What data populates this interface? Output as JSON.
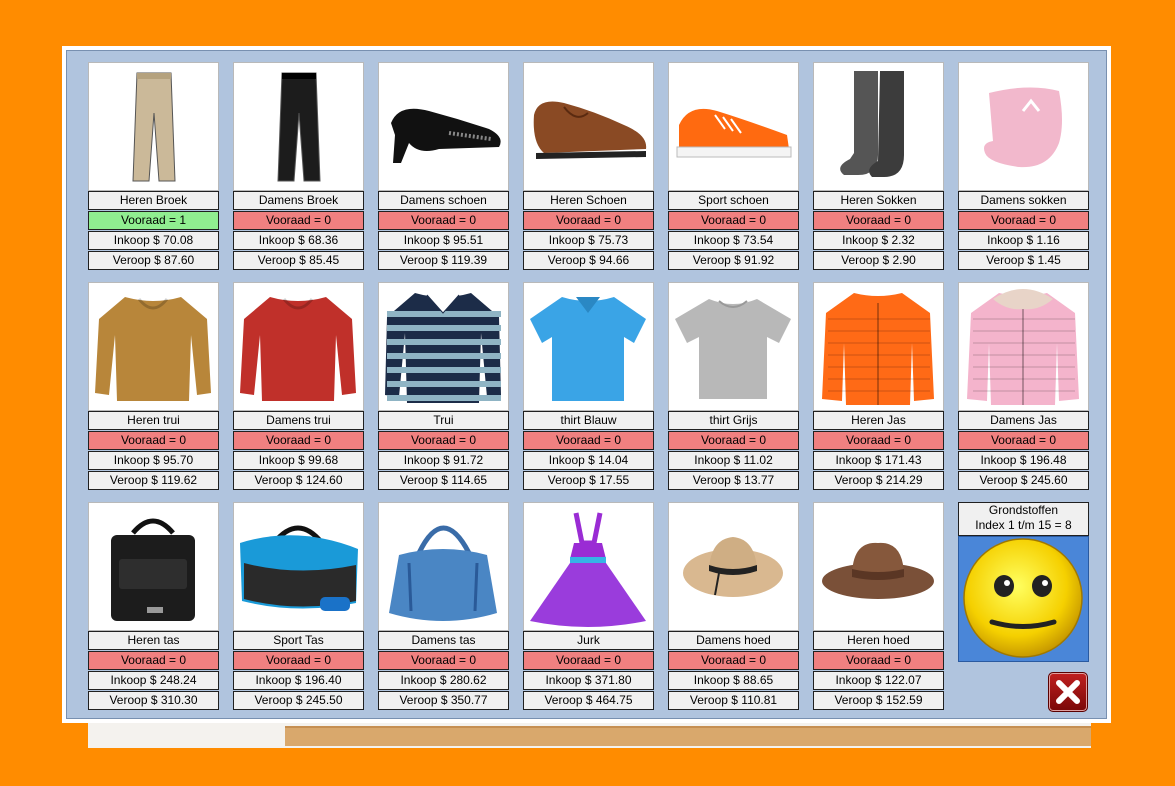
{
  "products": [
    {
      "name": "Heren Broek",
      "stock": "Vooraad = 1",
      "buy": "Inkoop  $ 70.08",
      "sell": "Veroop  $ 87.60",
      "in_stock": true,
      "icon": "pants-icon"
    },
    {
      "name": "Damens Broek",
      "stock": "Vooraad = 0",
      "buy": "Inkoop  $ 68.36",
      "sell": "Veroop  $ 85.45",
      "in_stock": false,
      "icon": "pants-icon"
    },
    {
      "name": "Damens schoen",
      "stock": "Vooraad = 0",
      "buy": "Inkoop  $ 95.51",
      "sell": "Veroop  $ 119.39",
      "in_stock": false,
      "icon": "heel-shoe-icon"
    },
    {
      "name": "Heren Schoen",
      "stock": "Vooraad = 0",
      "buy": "Inkoop  $ 75.73",
      "sell": "Veroop  $ 94.66",
      "in_stock": false,
      "icon": "dress-shoe-icon"
    },
    {
      "name": "Sport schoen",
      "stock": "Vooraad = 0",
      "buy": "Inkoop  $ 73.54",
      "sell": "Veroop  $ 91.92",
      "in_stock": false,
      "icon": "sneaker-icon"
    },
    {
      "name": "Heren Sokken",
      "stock": "Vooraad = 0",
      "buy": "Inkoop  $ 2.32",
      "sell": "Veroop  $ 2.90",
      "in_stock": false,
      "icon": "socks-icon"
    },
    {
      "name": "Damens sokken",
      "stock": "Vooraad = 0",
      "buy": "Inkoop  $ 1.16",
      "sell": "Veroop  $ 1.45",
      "in_stock": false,
      "icon": "sock-icon"
    },
    {
      "name": "Heren trui",
      "stock": "Vooraad = 0",
      "buy": "Inkoop  $ 95.70",
      "sell": "Veroop  $ 119.62",
      "in_stock": false,
      "icon": "sweater-icon"
    },
    {
      "name": "Damens trui",
      "stock": "Vooraad = 0",
      "buy": "Inkoop  $ 99.68",
      "sell": "Veroop  $ 124.60",
      "in_stock": false,
      "icon": "sweater-icon"
    },
    {
      "name": "Trui",
      "stock": "Vooraad = 0",
      "buy": "Inkoop  $ 91.72",
      "sell": "Veroop  $ 114.65",
      "in_stock": false,
      "icon": "striped-sweater-icon"
    },
    {
      "name": "thirt Blauw",
      "stock": "Vooraad = 0",
      "buy": "Inkoop  $ 14.04",
      "sell": "Veroop  $ 17.55",
      "in_stock": false,
      "icon": "polo-shirt-icon"
    },
    {
      "name": "thirt Grijs",
      "stock": "Vooraad = 0",
      "buy": "Inkoop  $ 11.02",
      "sell": "Veroop  $ 13.77",
      "in_stock": false,
      "icon": "tshirt-icon"
    },
    {
      "name": "Heren Jas",
      "stock": "Vooraad = 0",
      "buy": "Inkoop  $ 171.43",
      "sell": "Veroop  $ 214.29",
      "in_stock": false,
      "icon": "jacket-icon"
    },
    {
      "name": "Damens Jas",
      "stock": "Vooraad = 0",
      "buy": "Inkoop  $ 196.48",
      "sell": "Veroop  $ 245.60",
      "in_stock": false,
      "icon": "jacket-icon"
    },
    {
      "name": "Heren tas",
      "stock": "Vooraad = 0",
      "buy": "Inkoop  $ 248.24",
      "sell": "Veroop  $ 310.30",
      "in_stock": false,
      "icon": "laptop-bag-icon"
    },
    {
      "name": "Sport Tas",
      "stock": "Vooraad = 0",
      "buy": "Inkoop  $ 196.40",
      "sell": "Veroop  $ 245.50",
      "in_stock": false,
      "icon": "sport-bag-icon"
    },
    {
      "name": "Damens tas",
      "stock": "Vooraad = 0",
      "buy": "Inkoop  $ 280.62",
      "sell": "Veroop  $ 350.77",
      "in_stock": false,
      "icon": "handbag-icon"
    },
    {
      "name": "Jurk",
      "stock": "Vooraad = 0",
      "buy": "Inkoop  $ 371.80",
      "sell": "Veroop  $ 464.75",
      "in_stock": false,
      "icon": "dress-icon"
    },
    {
      "name": "Damens hoed",
      "stock": "Vooraad = 0",
      "buy": "Inkoop  $ 88.65",
      "sell": "Veroop  $ 110.81",
      "in_stock": false,
      "icon": "sun-hat-icon"
    },
    {
      "name": "Heren hoed",
      "stock": "Vooraad = 0",
      "buy": "Inkoop  $ 122.07",
      "sell": "Veroop  $ 152.59",
      "in_stock": false,
      "icon": "fedora-icon"
    }
  ],
  "grondstoffen": {
    "title": "Grondstoffen",
    "index": "Index 1 t/m 15 =  8"
  },
  "colors": {
    "background": "#ff8c00",
    "panel": "#b0c4de",
    "stock_out": "#f08080",
    "stock_in": "#90ee90",
    "smiley_bg": "#4a86d8"
  },
  "icons": {
    "mood": "smiley-face-icon",
    "close": "close-icon"
  }
}
